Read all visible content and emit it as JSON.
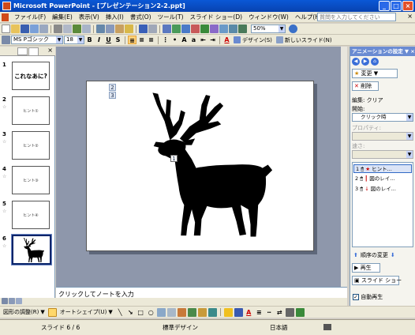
{
  "window": {
    "title": "Microsoft PowerPoint - [プレゼンテーション2-2.ppt]"
  },
  "menu": {
    "items": [
      "ファイル(F)",
      "編集(E)",
      "表示(V)",
      "挿入(I)",
      "書式(O)",
      "ツール(T)",
      "スライド ショー(D)",
      "ウィンドウ(W)",
      "ヘルプ(H)"
    ],
    "help_placeholder": "質問を入力してください"
  },
  "toolbar_format": {
    "font_name": "MS Pゴシック",
    "font_size": "18",
    "bold": "B",
    "italic": "I",
    "underline": "U",
    "shadow": "S",
    "design_label": "デザイン(S)",
    "new_slide_label": "新しいスライド(N)"
  },
  "toolbar_standard": {
    "zoom": "50%"
  },
  "slides": [
    {
      "num": "1",
      "text": "これなあに?"
    },
    {
      "num": "2",
      "text": "ヒント①"
    },
    {
      "num": "3",
      "text": "ヒント②"
    },
    {
      "num": "4",
      "text": "ヒント③"
    },
    {
      "num": "5",
      "text": "ヒント④"
    },
    {
      "num": "6",
      "text": ""
    }
  ],
  "slide_tags": [
    "2",
    "3",
    "1"
  ],
  "notes_placeholder": "クリックしてノートを入力",
  "drawbar": {
    "draw_label": "図形の調整(R)",
    "autoshape_label": "オートシェイプ(U)"
  },
  "status": {
    "slide": "スライド 6 / 6",
    "design": "標準デザイン",
    "language": "日本語"
  },
  "taskpane": {
    "title": "アニメーションの設定",
    "change_label": "変更",
    "delete_label": "削除",
    "edit_label": "編集: クリア",
    "start_label": "開始:",
    "start_value": "クリック時",
    "property_label": "プロパティ:",
    "speed_label": "速さ:",
    "list": [
      {
        "num": "1",
        "label": "ヒント..."
      },
      {
        "num": "2",
        "label": "図のレイ..."
      },
      {
        "num": "3",
        "label": "図のレイ..."
      }
    ],
    "reorder_label": "順序の変更",
    "play_label": "再生",
    "slideshow_label": "スライド ショー",
    "autopreview_label": "自動再生"
  }
}
